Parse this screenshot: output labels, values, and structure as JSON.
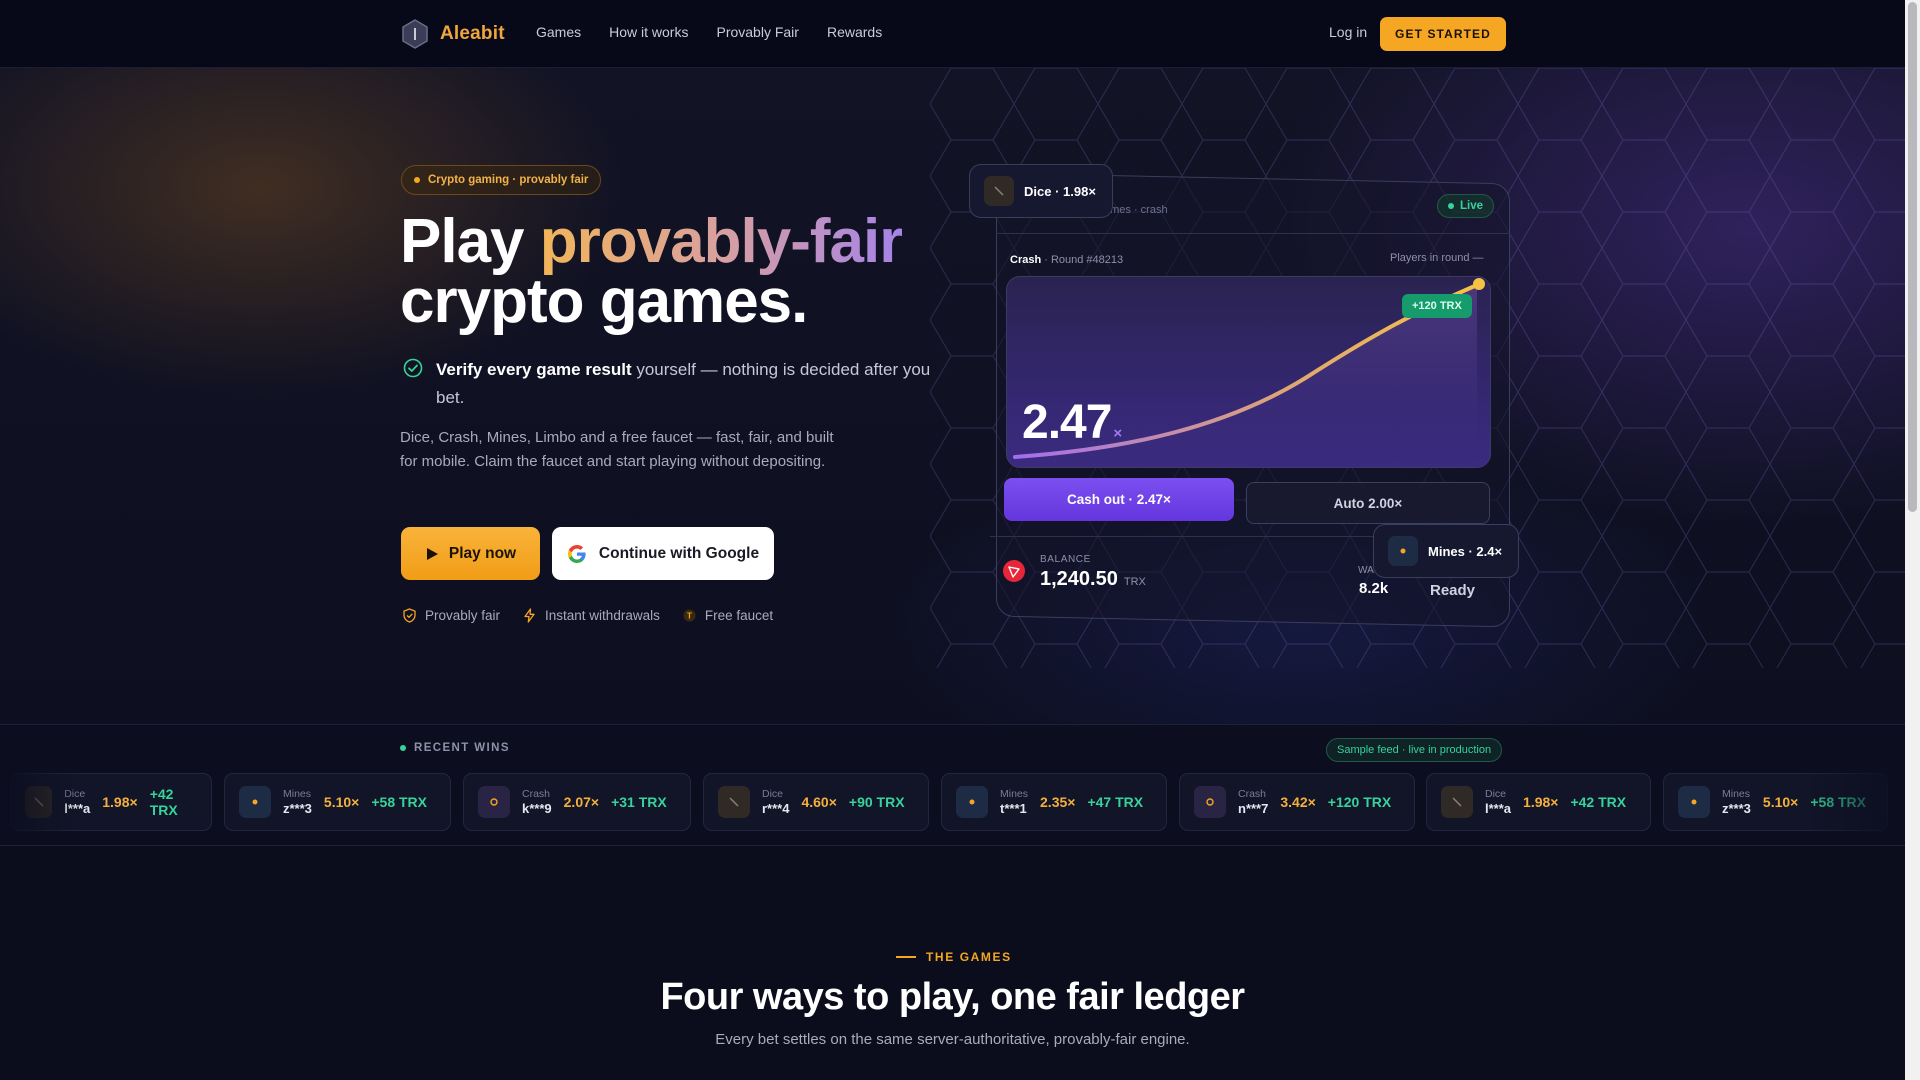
{
  "nav": {
    "brand": "Aleabit",
    "links": [
      "Games",
      "How it works",
      "Provably Fair",
      "Rewards"
    ],
    "login": "Log in",
    "cta": "GET STARTED"
  },
  "hero": {
    "badge": "Crypto gaming · provably fair",
    "title_a": "Play ",
    "title_grad": "provably-fair",
    "title_b": "crypto games.",
    "verify_bold": "Verify every game result",
    "verify_rest": " yourself — nothing is decided after you bet.",
    "description": "Dice, Crash, Mines, Limbo and a free faucet — fast, fair, and built for mobile. Claim the faucet and start playing without depositing.",
    "play_button": "Play now",
    "google_button": "Continue with Google",
    "features": [
      "Provably fair",
      "Instant withdrawals",
      "Free faucet"
    ]
  },
  "preview": {
    "top_text": "ames · crash",
    "live": "Live",
    "game": "Crash",
    "round": " · Round #48213",
    "players": "Players in round —",
    "multiplier": "2.47",
    "multiplier_suffix": "×",
    "win_pill": "+120 TRX",
    "cashout": "Cash out · 2.47×",
    "auto": "Auto 2.00×",
    "balance_label": "BALANCE",
    "balance_value": "1,240.50",
    "balance_unit": "TRX",
    "wa_label": "WA",
    "wa_value": "8.2k",
    "ready": "Ready",
    "float_dice": "Dice · 1.98×",
    "float_mines": "Mines · 2.4×"
  },
  "recent_wins": {
    "title": "RECENT WINS",
    "sample": "Sample feed · live in production",
    "items": [
      {
        "game": "Dice",
        "user": "l***a",
        "mult": "1.98×",
        "amount": "+42 TRX",
        "icon": "dice-icon"
      },
      {
        "game": "Mines",
        "user": "z***3",
        "mult": "5.10×",
        "amount": "+58 TRX",
        "icon": "mines-icon"
      },
      {
        "game": "Crash",
        "user": "k***9",
        "mult": "2.07×",
        "amount": "+31 TRX",
        "icon": "crash-icon"
      },
      {
        "game": "Dice",
        "user": "r***4",
        "mult": "4.60×",
        "amount": "+90 TRX",
        "icon": "dice-icon"
      },
      {
        "game": "Mines",
        "user": "t***1",
        "mult": "2.35×",
        "amount": "+47 TRX",
        "icon": "mines-icon"
      },
      {
        "game": "Crash",
        "user": "n***7",
        "mult": "3.42×",
        "amount": "+120 TRX",
        "icon": "crash-icon"
      },
      {
        "game": "Dice",
        "user": "l***a",
        "mult": "1.98×",
        "amount": "+42 TRX",
        "icon": "dice-icon"
      },
      {
        "game": "Mines",
        "user": "z***3",
        "mult": "5.10×",
        "amount": "+58 TRX",
        "icon": "mines-icon"
      }
    ]
  },
  "games_section": {
    "kicker": "THE GAMES",
    "title": "Four ways to play, one fair ledger",
    "subtitle": "Every bet settles on the same server-authoritative, provably-fair engine."
  },
  "colors": {
    "accent": "#f5a623",
    "purple": "#7b4ff0",
    "green": "#36d39a",
    "background": "#0b0d1c"
  }
}
